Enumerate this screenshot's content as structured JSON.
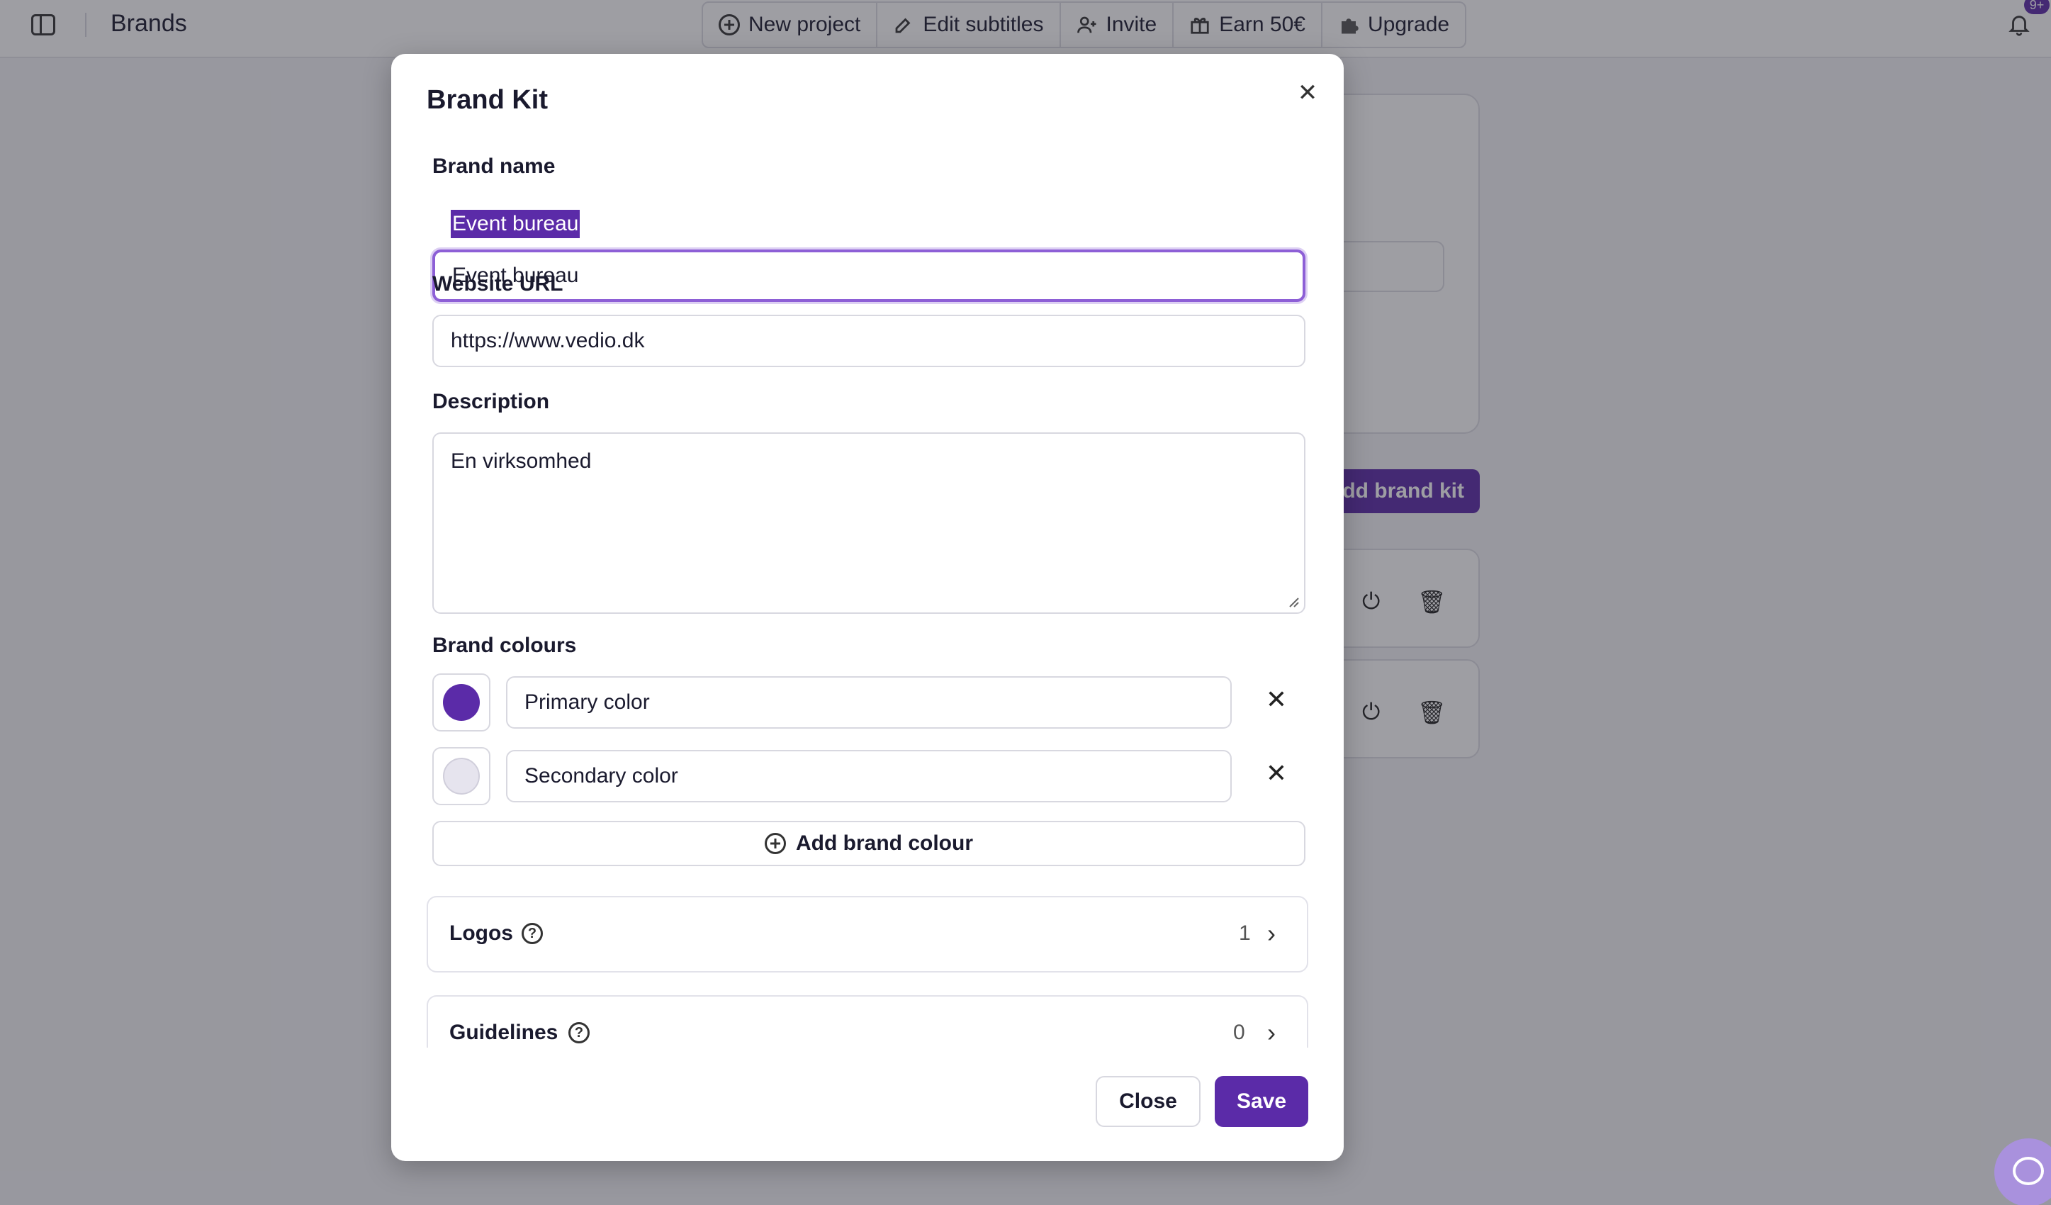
{
  "topbar": {
    "title": "Brands",
    "actions": [
      {
        "label": "New project",
        "icon": "plus-circle-icon"
      },
      {
        "label": "Edit subtitles",
        "icon": "edit-icon"
      },
      {
        "label": "Invite",
        "icon": "user-plus-icon"
      },
      {
        "label": "Earn 50€",
        "icon": "gift-icon"
      },
      {
        "label": "Upgrade",
        "icon": "puzzle-icon"
      }
    ],
    "notification_badge": "9+"
  },
  "background": {
    "add_brand_kit_label": "Add brand kit"
  },
  "modal": {
    "title": "Brand Kit",
    "brand_name": {
      "label": "Brand name",
      "value": "Event bureau"
    },
    "website": {
      "label": "Website URL",
      "value": "https://www.vedio.dk"
    },
    "description": {
      "label": "Description",
      "value": "En virksomhed"
    },
    "brand_colours": {
      "label": "Brand colours",
      "items": [
        {
          "name": "Primary color",
          "color": "#5b2ba8"
        },
        {
          "name": "Secondary color",
          "color": "#e6e4ee"
        }
      ],
      "add_label": "Add brand colour"
    },
    "sections": [
      {
        "title": "Logos",
        "count": "1"
      },
      {
        "title": "Guidelines",
        "count": "0"
      }
    ],
    "buttons": {
      "close": "Close",
      "save": "Save"
    }
  },
  "colors": {
    "accent": "#5b2ba8",
    "focus": "#8d5fd6"
  }
}
